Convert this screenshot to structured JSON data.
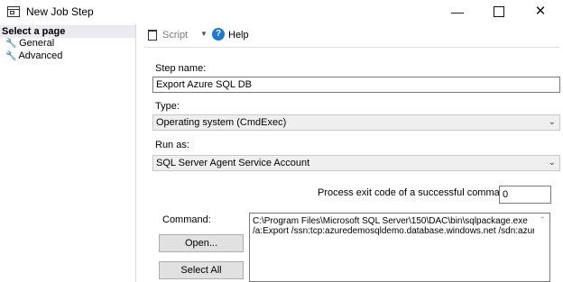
{
  "window": {
    "title": "New Job Step",
    "minimize": "—",
    "close": "✕"
  },
  "sidebar": {
    "header": "Select a page",
    "items": [
      {
        "label": "General"
      },
      {
        "label": "Advanced"
      }
    ]
  },
  "toolbar": {
    "script_label": "Script",
    "help_label": "Help",
    "help_glyph": "?"
  },
  "form": {
    "step_name_label": "Step name:",
    "step_name_value": "Export Azure SQL DB",
    "type_label": "Type:",
    "type_value": "Operating system (CmdExec)",
    "run_as_label": "Run as:",
    "run_as_value": "SQL Server Agent Service Account",
    "exit_code_label": "Process exit code of a successful command:",
    "exit_code_value": "0",
    "command_label": "Command:",
    "open_button": "Open...",
    "select_all_button": "Select All",
    "command_text": "C:\\Program Files\\Microsoft SQL Server\\150\\DAC\\bin\\sqlpackage.exe\n/a:Export /ssn:tcp:azuredemosqldemo.database.windows.net /sdn:azurec"
  },
  "colors": {
    "help_icon": "#1c7ad4",
    "selected_header_bg": "#eaeaf0",
    "combo_bg": "#efefef",
    "button_bg": "#e1e1e1"
  }
}
